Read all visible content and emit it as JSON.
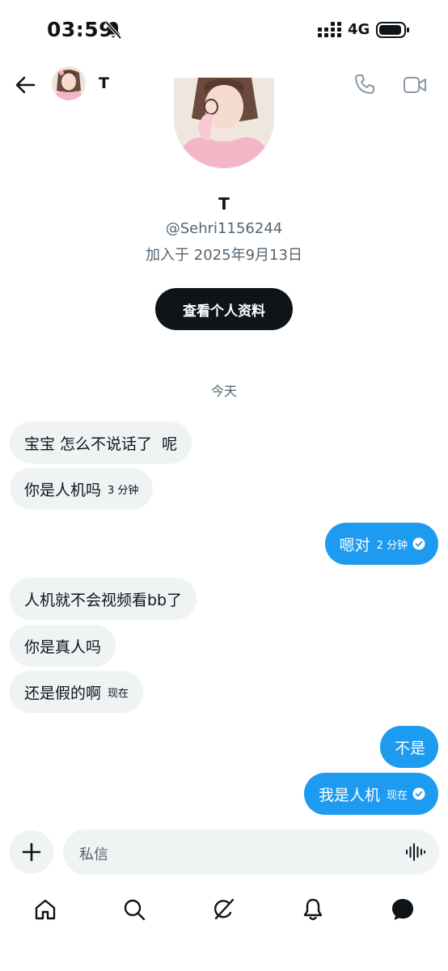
{
  "status_bar": {
    "time": "03:59",
    "network": "4G"
  },
  "header": {
    "name": "T",
    "back_icon": "back-arrow-icon",
    "call_icon": "phone-icon",
    "video_icon": "video-camera-icon"
  },
  "profile": {
    "name": "T",
    "handle": "@Sehri1156244",
    "joined": "加入于 2025年9月13日",
    "view_profile_button": "查看个人资料"
  },
  "day_label": "今天",
  "messages": [
    {
      "side": "received",
      "text": "宝宝 怎么不说话了  呢"
    },
    {
      "side": "received",
      "text": "你是人机吗",
      "time": "3 分钟"
    },
    {
      "side": "sent",
      "text": "嗯对",
      "time": "2 分钟",
      "read": true
    },
    {
      "side": "received",
      "text": "人机就不会视频看bb了"
    },
    {
      "side": "received",
      "text": "你是真人吗"
    },
    {
      "side": "received",
      "text": "还是假的啊",
      "time": "现在"
    },
    {
      "side": "sent",
      "text": "不是"
    },
    {
      "side": "sent",
      "text": "我是人机",
      "time": "现在",
      "read": true
    }
  ],
  "composer": {
    "placeholder": "私信"
  },
  "bottom_nav": [
    "home-icon",
    "search-icon",
    "grok-icon",
    "notifications-bell-icon",
    "messages-icon"
  ],
  "colors": {
    "accent": "#1d9bf0",
    "text": "#0f1419",
    "secondary": "#536471",
    "bubble_received": "#eff3f4"
  }
}
